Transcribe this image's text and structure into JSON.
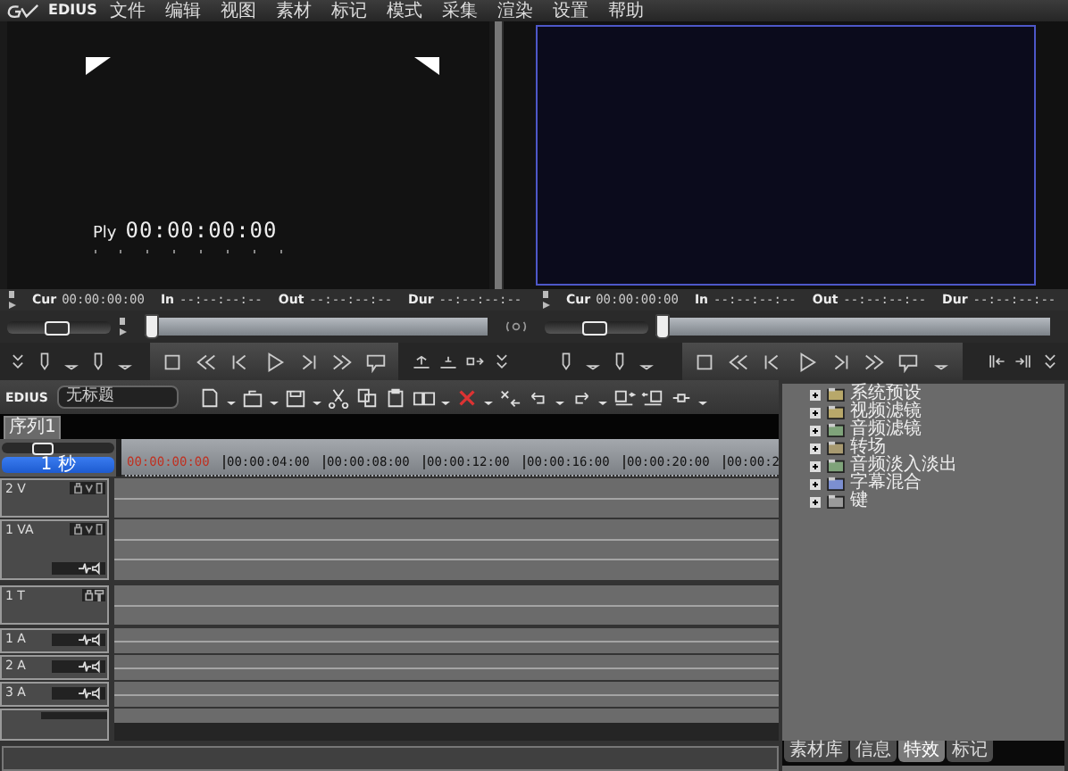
{
  "menu_bar": {
    "logo": "EDIUS",
    "items": [
      "文件",
      "编辑",
      "视图",
      "素材",
      "标记",
      "模式",
      "采集",
      "渲染",
      "设置",
      "帮助"
    ]
  },
  "player": {
    "overlay_label": "Ply",
    "overlay_timecode": "00:00:00:00",
    "shuttle": {
      "level": 0.45
    },
    "scrubber": {
      "level": 0
    },
    "timecodes": [
      {
        "label": "Cur",
        "value": "00:00:00:00"
      },
      {
        "label": "In",
        "value": "--:--:--:--"
      },
      {
        "label": "Out",
        "value": "--:--:--:--"
      },
      {
        "label": "Dur",
        "value": "--:--:--:--"
      }
    ]
  },
  "recorder": {
    "shuttle": {
      "level": 0.45
    },
    "scrubber": {
      "level": 0
    },
    "timecodes": [
      {
        "label": "Cur",
        "value": "00:00:00:00"
      },
      {
        "label": "In",
        "value": "--:--:--:--"
      },
      {
        "label": "Out",
        "value": "--:--:--:--"
      },
      {
        "label": "Dur",
        "value": "--:--:--:--"
      }
    ]
  },
  "timeline": {
    "logo": "EDIUS",
    "project_name": "无标题",
    "sequence_tabs": [
      {
        "label": "序列1",
        "selected": true
      }
    ],
    "zoom_slider": {
      "level": 0.35
    },
    "zoom": "1 秒",
    "ruler": [
      {
        "label": "00:00:00:00",
        "kind": "current"
      },
      {
        "label": "00:00:04:00",
        "kind": "tick"
      },
      {
        "label": "00:00:08:00",
        "kind": "tick"
      },
      {
        "label": "00:00:12:00",
        "kind": "tick"
      },
      {
        "label": "00:00:16:00",
        "kind": "tick"
      },
      {
        "label": "00:00:20:00",
        "kind": "tick"
      },
      {
        "label": "00:00:2",
        "kind": "tick"
      }
    ],
    "tracks": [
      {
        "name": "2 V",
        "kind": "video"
      },
      {
        "name": "1 VA",
        "kind": "va"
      },
      {
        "name": "1 T",
        "kind": "title"
      },
      {
        "name": "1 A",
        "kind": "audio"
      },
      {
        "name": "2 A",
        "kind": "audio"
      },
      {
        "name": "3 A",
        "kind": "audio"
      },
      {
        "kind": "audio_cut"
      }
    ]
  },
  "effects_panel": {
    "tree": [
      {
        "label": "系统预设",
        "kind": "folder",
        "expanded": false
      },
      {
        "label": "视频滤镜",
        "kind": "video",
        "expanded": false
      },
      {
        "label": "音频滤镜",
        "kind": "audio",
        "expanded": false
      },
      {
        "label": "转场",
        "kind": "transition",
        "expanded": false
      },
      {
        "label": "音频淡入淡出",
        "kind": "audio",
        "expanded": false
      },
      {
        "label": "字幕混合",
        "kind": "title",
        "expanded": false
      },
      {
        "label": "键",
        "kind": "key",
        "expanded": false
      }
    ],
    "tabs": [
      {
        "label": "素材库",
        "selected": false
      },
      {
        "label": "信息",
        "selected": false
      },
      {
        "label": "特效",
        "selected": true
      },
      {
        "label": "标记",
        "selected": false
      }
    ]
  }
}
